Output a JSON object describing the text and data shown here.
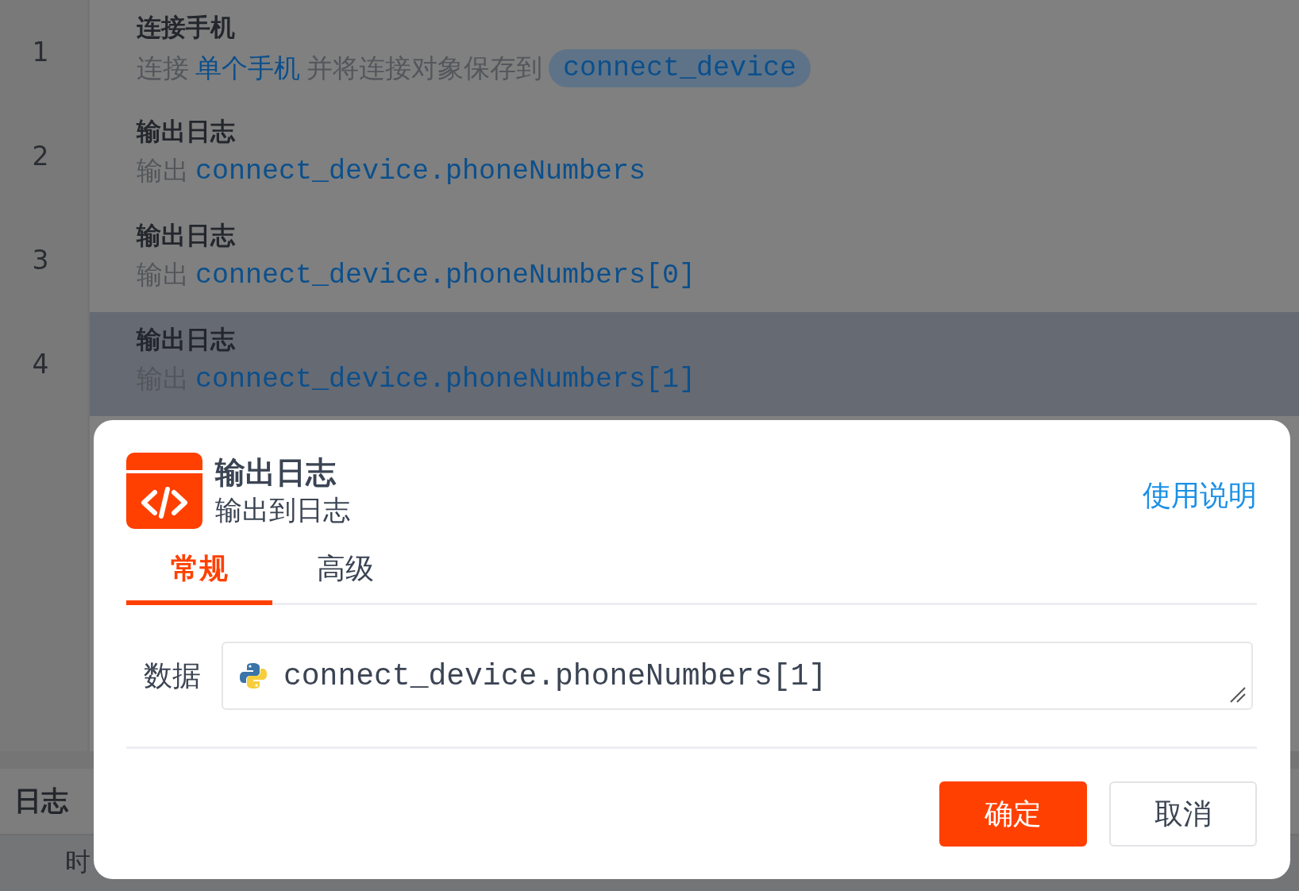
{
  "steps": [
    {
      "number": "1",
      "title": "连接手机",
      "selected": false,
      "description": [
        {
          "kind": "text",
          "text": "连接"
        },
        {
          "kind": "link",
          "text": "单个手机"
        },
        {
          "kind": "text",
          "text": "并将连接对象保存到"
        },
        {
          "kind": "variable",
          "text": "connect_device"
        }
      ]
    },
    {
      "number": "2",
      "title": "输出日志",
      "selected": false,
      "description": [
        {
          "kind": "text",
          "text": "输出"
        },
        {
          "kind": "code",
          "text": "connect_device.phoneNumbers"
        }
      ]
    },
    {
      "number": "3",
      "title": "输出日志",
      "selected": false,
      "description": [
        {
          "kind": "text",
          "text": "输出"
        },
        {
          "kind": "code",
          "text": "connect_device.phoneNumbers[0]"
        }
      ]
    },
    {
      "number": "4",
      "title": "输出日志",
      "selected": true,
      "description": [
        {
          "kind": "text",
          "text": "输出"
        },
        {
          "kind": "code",
          "text": "connect_device.phoneNumbers[1]"
        }
      ]
    }
  ],
  "log_panel": {
    "title": "日志",
    "text": "时"
  },
  "dialog": {
    "title": "输出日志",
    "subtitle": "输出到日志",
    "help_link": "使用说明",
    "tabs": [
      {
        "label": "常规",
        "selected": true
      },
      {
        "label": "高级",
        "selected": false
      }
    ],
    "fields": [
      {
        "label": "数据",
        "value": "connect_device.phoneNumbers[1]"
      }
    ],
    "buttons": [
      {
        "kind": "primary",
        "label": "确定"
      },
      {
        "kind": "secondary",
        "label": "取消"
      }
    ]
  }
}
